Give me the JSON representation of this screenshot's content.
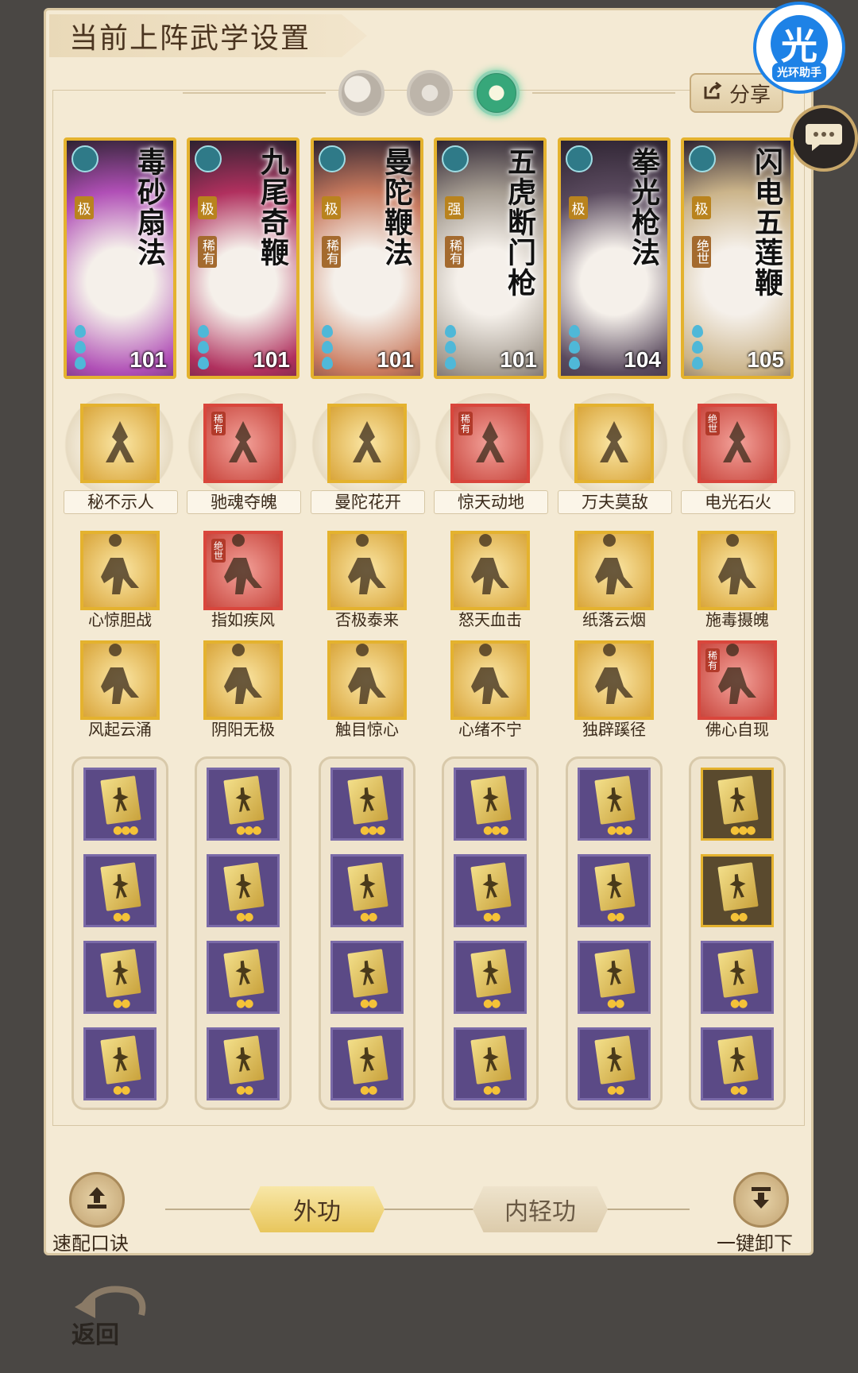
{
  "header": {
    "title": "当前上阵武学设置",
    "share_label": "分享"
  },
  "app_badge": {
    "glyph": "光",
    "name": "光环助手"
  },
  "tabs": [
    {
      "name": "moon",
      "active": false
    },
    {
      "name": "sun",
      "active": false
    },
    {
      "name": "jade",
      "active": true
    }
  ],
  "cards": [
    {
      "name": "毒砂扇法",
      "tier": "极",
      "rarity": "",
      "level": "101",
      "bg": "#b04fb6"
    },
    {
      "name": "九尾奇鞭",
      "tier": "极",
      "rarity": "稀有",
      "level": "101",
      "bg": "#b0305e"
    },
    {
      "name": "曼陀鞭法",
      "tier": "极",
      "rarity": "稀有",
      "level": "101",
      "bg": "#c97a5e"
    },
    {
      "name": "五虎断门枪",
      "tier": "强",
      "rarity": "稀有",
      "level": "101",
      "bg": "#a69d92"
    },
    {
      "name": "拳光枪法",
      "tier": "极",
      "rarity": "",
      "level": "104",
      "bg": "#5a4a5e"
    },
    {
      "name": "闪电五莲鞭",
      "tier": "极",
      "rarity": "绝世",
      "level": "105",
      "bg": "#cbb48a"
    }
  ],
  "main_skills": [
    {
      "label": "秘不示人",
      "tag": ""
    },
    {
      "label": "驰魂夺魄",
      "tag": "稀有"
    },
    {
      "label": "曼陀花开",
      "tag": ""
    },
    {
      "label": "惊天动地",
      "tag": "稀有"
    },
    {
      "label": "万夫莫敌",
      "tag": ""
    },
    {
      "label": "电光石火",
      "tag": "绝世"
    }
  ],
  "skills_row2": [
    {
      "label": "心惊胆战",
      "tag": ""
    },
    {
      "label": "指如疾风",
      "tag": "绝世"
    },
    {
      "label": "否极泰来",
      "tag": ""
    },
    {
      "label": "怒天血击",
      "tag": ""
    },
    {
      "label": "纸落云烟",
      "tag": ""
    },
    {
      "label": "施毒摄魄",
      "tag": ""
    }
  ],
  "skills_row3": [
    {
      "label": "风起云涌",
      "tag": ""
    },
    {
      "label": "阴阳无极",
      "tag": ""
    },
    {
      "label": "触目惊心",
      "tag": ""
    },
    {
      "label": "心绪不宁",
      "tag": ""
    },
    {
      "label": "独辟蹊径",
      "tag": ""
    },
    {
      "label": "佛心自现",
      "tag": "稀有"
    }
  ],
  "footer": {
    "quick_label": "速配口诀",
    "unload_label": "一键卸下",
    "tab_outer": "外功",
    "tab_inner": "内轻功"
  },
  "back_label": "返回"
}
